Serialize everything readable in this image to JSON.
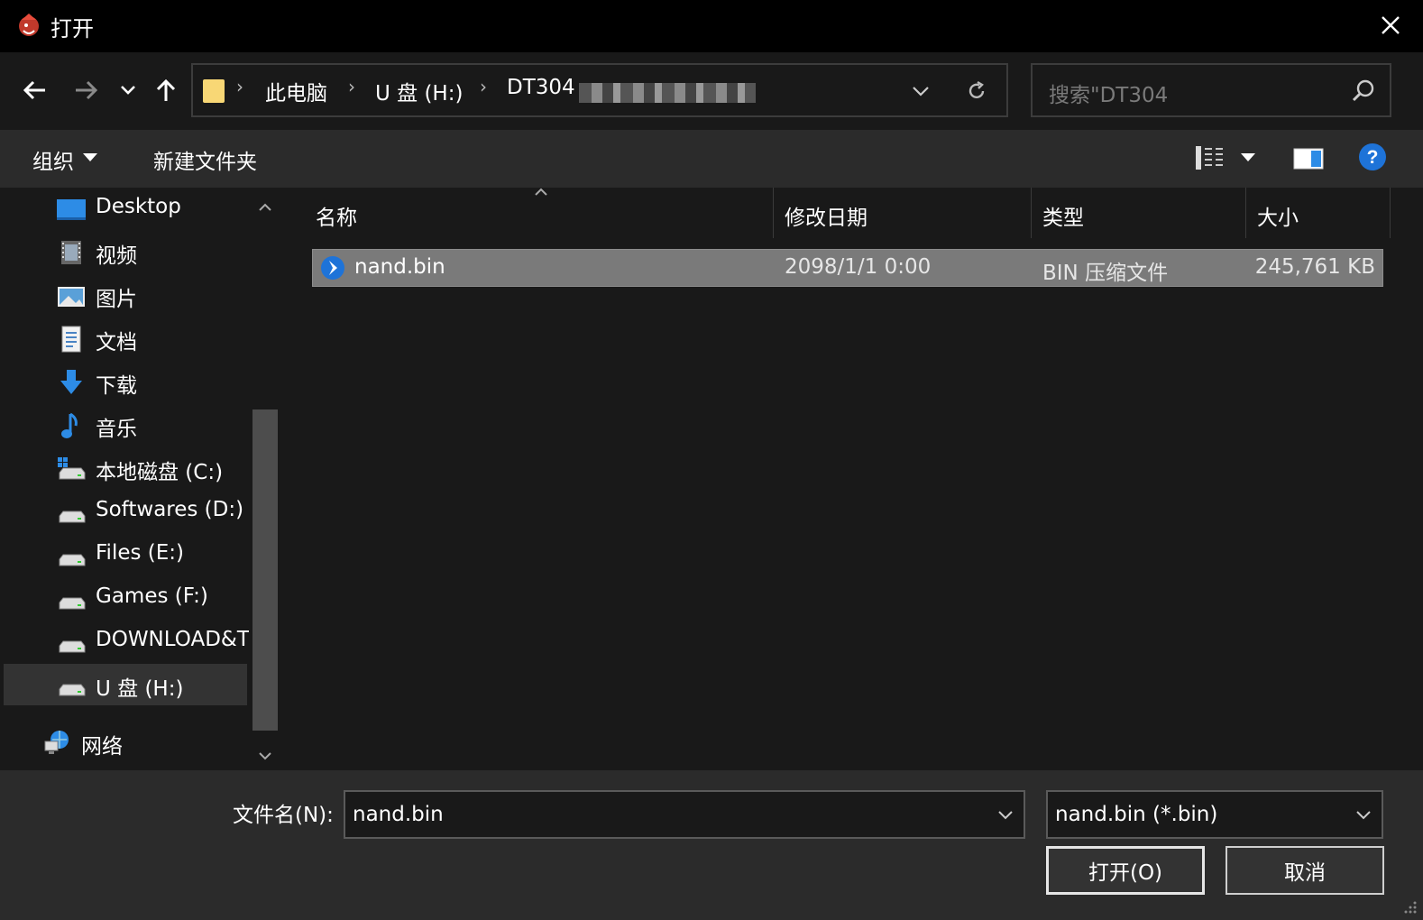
{
  "window": {
    "title": "打开"
  },
  "nav": {
    "breadcrumbs": [
      "此电脑",
      "U 盘 (H:)",
      "DT304"
    ],
    "search_placeholder": "搜索\"DT304"
  },
  "toolbar": {
    "organize_label": "组织",
    "new_folder_label": "新建文件夹"
  },
  "sidebar": {
    "items": [
      {
        "label": "Desktop",
        "icon": "desktop-icon"
      },
      {
        "label": "视频",
        "icon": "video-icon"
      },
      {
        "label": "图片",
        "icon": "picture-icon"
      },
      {
        "label": "文档",
        "icon": "document-icon"
      },
      {
        "label": "下载",
        "icon": "download-icon"
      },
      {
        "label": "音乐",
        "icon": "music-icon"
      },
      {
        "label": "本地磁盘 (C:)",
        "icon": "system-drive-icon"
      },
      {
        "label": "Softwares (D:)",
        "icon": "drive-icon"
      },
      {
        "label": "Files (E:)",
        "icon": "drive-icon"
      },
      {
        "label": "Games (F:)",
        "icon": "drive-icon"
      },
      {
        "label": "DOWNLOAD&T",
        "icon": "drive-icon"
      },
      {
        "label": "U 盘 (H:)",
        "icon": "drive-icon",
        "selected": true
      }
    ],
    "network_label": "网络"
  },
  "list": {
    "columns": [
      "名称",
      "修改日期",
      "类型",
      "大小"
    ],
    "rows": [
      {
        "name": "nand.bin",
        "date": "2098/1/1 0:00",
        "type": "BIN 压缩文件",
        "size": "245,761 KB",
        "selected": true
      }
    ]
  },
  "footer": {
    "filename_label": "文件名(N):",
    "filename_value": "nand.bin",
    "filter_value": "nand.bin (*.bin)",
    "open_label": "打开(O)",
    "cancel_label": "取消"
  },
  "colors": {
    "accent": "#0078d7",
    "folder": "#f8d775",
    "help": "#1e73d8"
  }
}
